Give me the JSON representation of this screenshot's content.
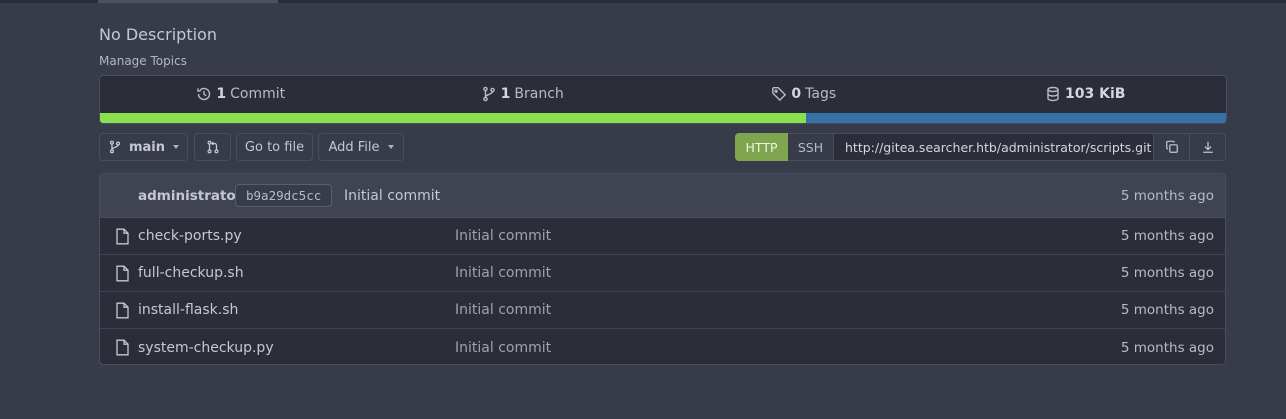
{
  "repo": {
    "description": "No Description",
    "manage_topics": "Manage Topics"
  },
  "stats": [
    {
      "icon": "history-icon",
      "count": "1",
      "label": "Commit"
    },
    {
      "icon": "branch-icon",
      "count": "1",
      "label": "Branch"
    },
    {
      "icon": "tag-icon",
      "count": "0",
      "label": "Tags"
    },
    {
      "icon": "database-icon",
      "count": "103 KiB",
      "label": ""
    }
  ],
  "language_bar": [
    {
      "color": "#89e051",
      "fraction": 0.627
    },
    {
      "color": "#3572a5",
      "fraction": 0.373
    }
  ],
  "toolbar": {
    "branch": "main",
    "go_to_file": "Go to file",
    "add_file": "Add File",
    "clone": {
      "http": "HTTP",
      "ssh": "SSH",
      "url": "http://gitea.searcher.htb/administrator/scripts.git"
    }
  },
  "latest_commit": {
    "author": "administrator",
    "sha": "b9a29dc5cc",
    "message": "Initial commit",
    "time": "5 months ago"
  },
  "files": [
    {
      "name": "check-ports.py",
      "message": "Initial commit",
      "time": "5 months ago"
    },
    {
      "name": "full-checkup.sh",
      "message": "Initial commit",
      "time": "5 months ago"
    },
    {
      "name": "install-flask.sh",
      "message": "Initial commit",
      "time": "5 months ago"
    },
    {
      "name": "system-checkup.py",
      "message": "Initial commit",
      "time": "5 months ago"
    }
  ],
  "colors": {
    "accent_http": "#7fa54e",
    "background": "#383c4a",
    "panel": "#2b2e39"
  }
}
